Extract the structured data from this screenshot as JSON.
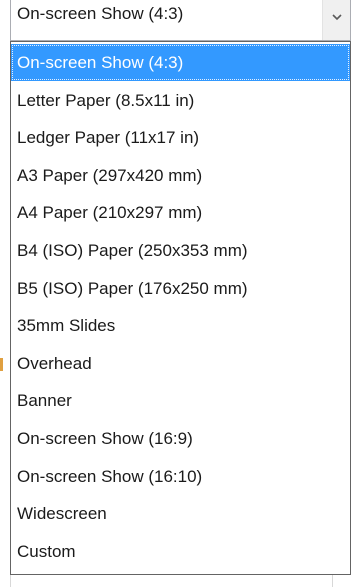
{
  "combo": {
    "value": "On-screen Show (4:3)",
    "button_icon": "chevron-down-icon"
  },
  "dropdown": {
    "selected_index": 0,
    "selected_color": "#3399ff",
    "options": [
      "On-screen Show (4:3)",
      "Letter Paper (8.5x11 in)",
      "Ledger Paper (11x17 in)",
      "A3 Paper (297x420 mm)",
      "A4 Paper (210x297 mm)",
      "B4 (ISO) Paper (250x353 mm)",
      "B5 (ISO) Paper (176x250 mm)",
      "35mm Slides",
      "Overhead",
      "Banner",
      "On-screen Show (16:9)",
      "On-screen Show (16:10)",
      "Widescreen",
      "Custom"
    ]
  }
}
